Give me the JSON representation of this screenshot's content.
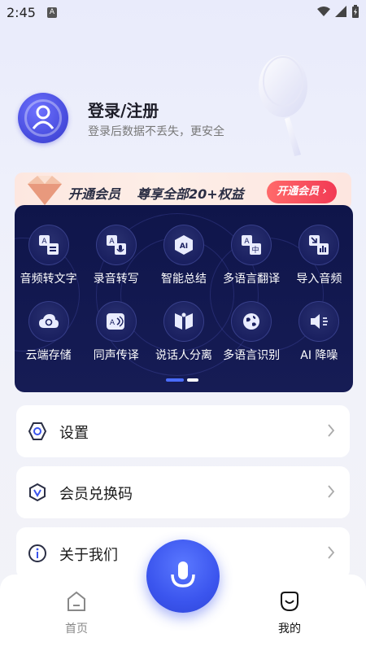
{
  "status_bar": {
    "time": "2:45",
    "notif_letter": "A"
  },
  "profile": {
    "title": "登录/注册",
    "subtitle": "登录后数据不丢失，更安全"
  },
  "vip_banner": {
    "text_open": "开通会员",
    "text_benefit": "尊享全部20+权益",
    "button_label": "开通会员 ›"
  },
  "features": {
    "row1": [
      {
        "label": "音频转文字",
        "icon": "audio-to-text-icon"
      },
      {
        "label": "录音转写",
        "icon": "recording-transcribe-icon"
      },
      {
        "label": "智能总结",
        "icon": "ai-summary-icon"
      },
      {
        "label": "多语言翻译",
        "icon": "multilingual-translate-icon"
      },
      {
        "label": "导入音频",
        "icon": "import-audio-icon"
      }
    ],
    "row2": [
      {
        "label": "云端存储",
        "icon": "cloud-storage-icon"
      },
      {
        "label": "同声传译",
        "icon": "simultaneous-interpretation-icon"
      },
      {
        "label": "说话人分离",
        "icon": "speaker-separation-icon"
      },
      {
        "label": "多语言识别",
        "icon": "multilingual-recognition-icon"
      },
      {
        "label": "AI 降噪",
        "icon": "ai-noise-reduction-icon"
      }
    ],
    "page_current": 1,
    "page_total": 2
  },
  "menu": {
    "settings": {
      "label": "设置",
      "icon": "settings-hex-icon"
    },
    "redeem": {
      "label": "会员兑换码",
      "icon": "vip-v-icon"
    },
    "about": {
      "label": "关于我们",
      "icon": "info-icon"
    }
  },
  "bottom_nav": {
    "home_label": "首页",
    "mine_label": "我的"
  },
  "colors": {
    "accent": "#3b55ee",
    "panel_bg": "#0f154a",
    "vip_btn": "#f23a54"
  }
}
